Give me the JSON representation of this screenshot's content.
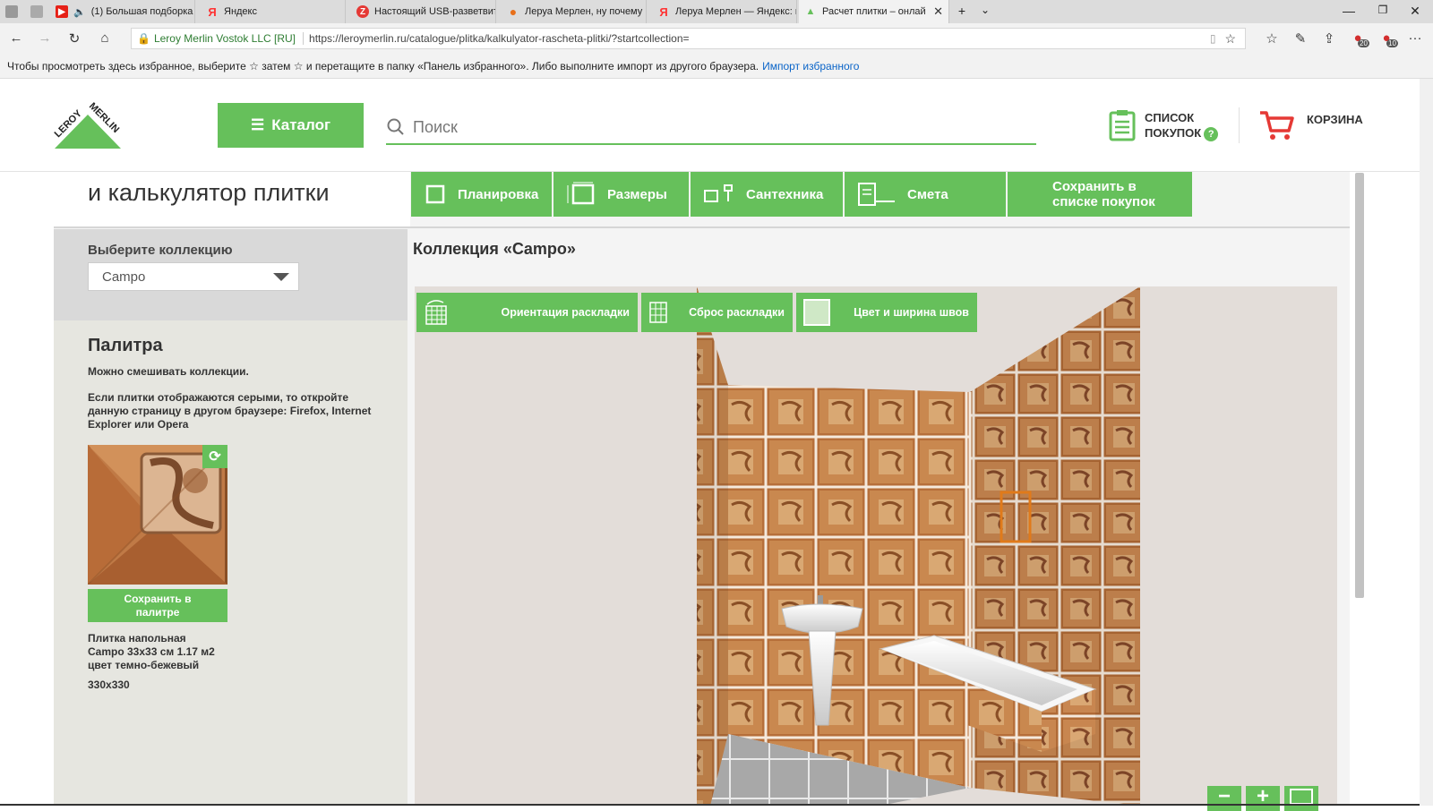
{
  "browser": {
    "tabs": [
      {
        "label": "",
        "favicon": "tab-manager-icon",
        "color": "#888888"
      },
      {
        "label": "",
        "favicon": "tab-preview-icon",
        "color": "#888888"
      },
      {
        "label": "(1) Большая подборка",
        "favicon": "youtube-icon",
        "color": "#e62117",
        "audio": "🔈"
      },
      {
        "label": "Яндекс",
        "favicon": "yandex-icon",
        "color": "#ff3333",
        "glyph": "Я"
      },
      {
        "label": "Настоящий USB-разветвит",
        "favicon": "zen-icon",
        "color": "#e53935",
        "glyph": "Z"
      },
      {
        "label": "Леруа Мерлен, ну почему",
        "favicon": "firefox-icon",
        "color": "#e8701a",
        "glyph": "●"
      },
      {
        "label": "Леруа Мерлен — Яндекс: н",
        "favicon": "yandex-search-icon",
        "color": "#ff3333",
        "glyph": "Я"
      },
      {
        "label": "Расчет плитки – онлай",
        "favicon": "leroy-icon",
        "color": "#66c05b",
        "glyph": "▲"
      }
    ],
    "new_tab": "+",
    "tab_list": "⌄",
    "window": {
      "minimize": "—",
      "restore": "❐",
      "close": "✕"
    },
    "address": {
      "org": "Leroy Merlin Vostok LLC [RU]",
      "url": "https://leroymerlin.ru/catalogue/plitka/kalkulyator-rascheta-plitki/?startcollection="
    },
    "badges": {
      "ext1": "20",
      "ext2": "10"
    },
    "favorites_text": "Чтобы просмотреть здесь избранное, выберите  ☆  затем ☆ и перетащите в папку «Панель избранного». Либо выполните импорт из другого браузера.",
    "favorites_import": "Импорт избранного"
  },
  "header": {
    "logo_text": "LEROY MERLIN",
    "catalog": "Каталог",
    "search_placeholder": "Поиск",
    "shopping_list": [
      "СПИСОК",
      "ПОКУПОК"
    ],
    "help": "?",
    "cart": "КОРЗИНА",
    "accent": "#66c05b"
  },
  "app": {
    "title": "и калькулятор плитки",
    "tabs": [
      {
        "label": "Планировка",
        "icon": "layout-icon"
      },
      {
        "label": "Размеры",
        "icon": "dimensions-icon"
      },
      {
        "label": "Сантехника",
        "icon": "plumbing-icon"
      },
      {
        "label": "Смета",
        "icon": "estimate-icon"
      },
      {
        "label": "Сохранить в списке покупок",
        "line1": "Сохранить в",
        "line2": "списке покупок"
      }
    ],
    "collection_label": "Выберите коллекцию",
    "collection_value": "Campo",
    "collection_title": "Коллекция «Campo»",
    "palette": {
      "title": "Палитра",
      "note1": "Можно смешивать коллекции.",
      "note2": "Если плитки отображаются серыми, то откройте данную страницу в другом браузере: Firefox, Internet Explorer или Opera",
      "refresh": "⟳",
      "save_line1": "Сохранить в",
      "save_line2": "палитре",
      "tile_line1": "Плитка напольная",
      "tile_line2": "Campo 33x33 см 1.17 м2",
      "tile_line3": "цвет темно-бежевый",
      "tile_size": "330x330"
    },
    "view_tools": [
      {
        "label": "Ориентация раскладки",
        "icon": "orientation-icon"
      },
      {
        "label": "Сброс раскладки",
        "icon": "grid-reset-icon"
      },
      {
        "label": "Цвет и ширина швов",
        "icon": "seam-color-icon"
      }
    ],
    "zoom": {
      "out": "−",
      "in": "+",
      "fit": "fit-icon"
    }
  }
}
